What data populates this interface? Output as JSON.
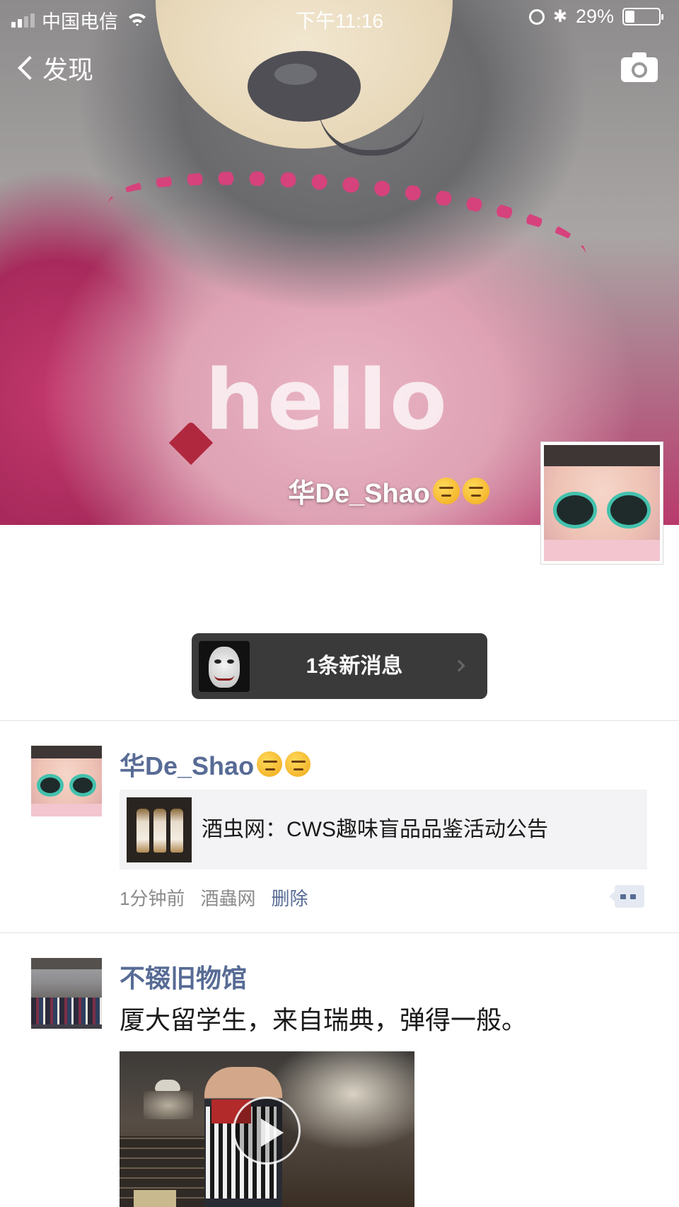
{
  "status_bar": {
    "carrier": "中国电信",
    "time": "下午11:16",
    "battery_text": "29%",
    "battery_level": 0.29
  },
  "nav": {
    "back_label": "发现"
  },
  "profile": {
    "name": "华De_Shao"
  },
  "new_message": {
    "label": "1条新消息"
  },
  "posts": [
    {
      "author": "华De_Shao",
      "share_title": "酒虫网：CWS趣味盲品品鉴活动公告",
      "time": "1分钟前",
      "source": "酒蟲网",
      "delete_label": "删除"
    },
    {
      "author": "不辍旧物馆",
      "text": "厦大留学生，来自瑞典，弹得一般。"
    }
  ]
}
